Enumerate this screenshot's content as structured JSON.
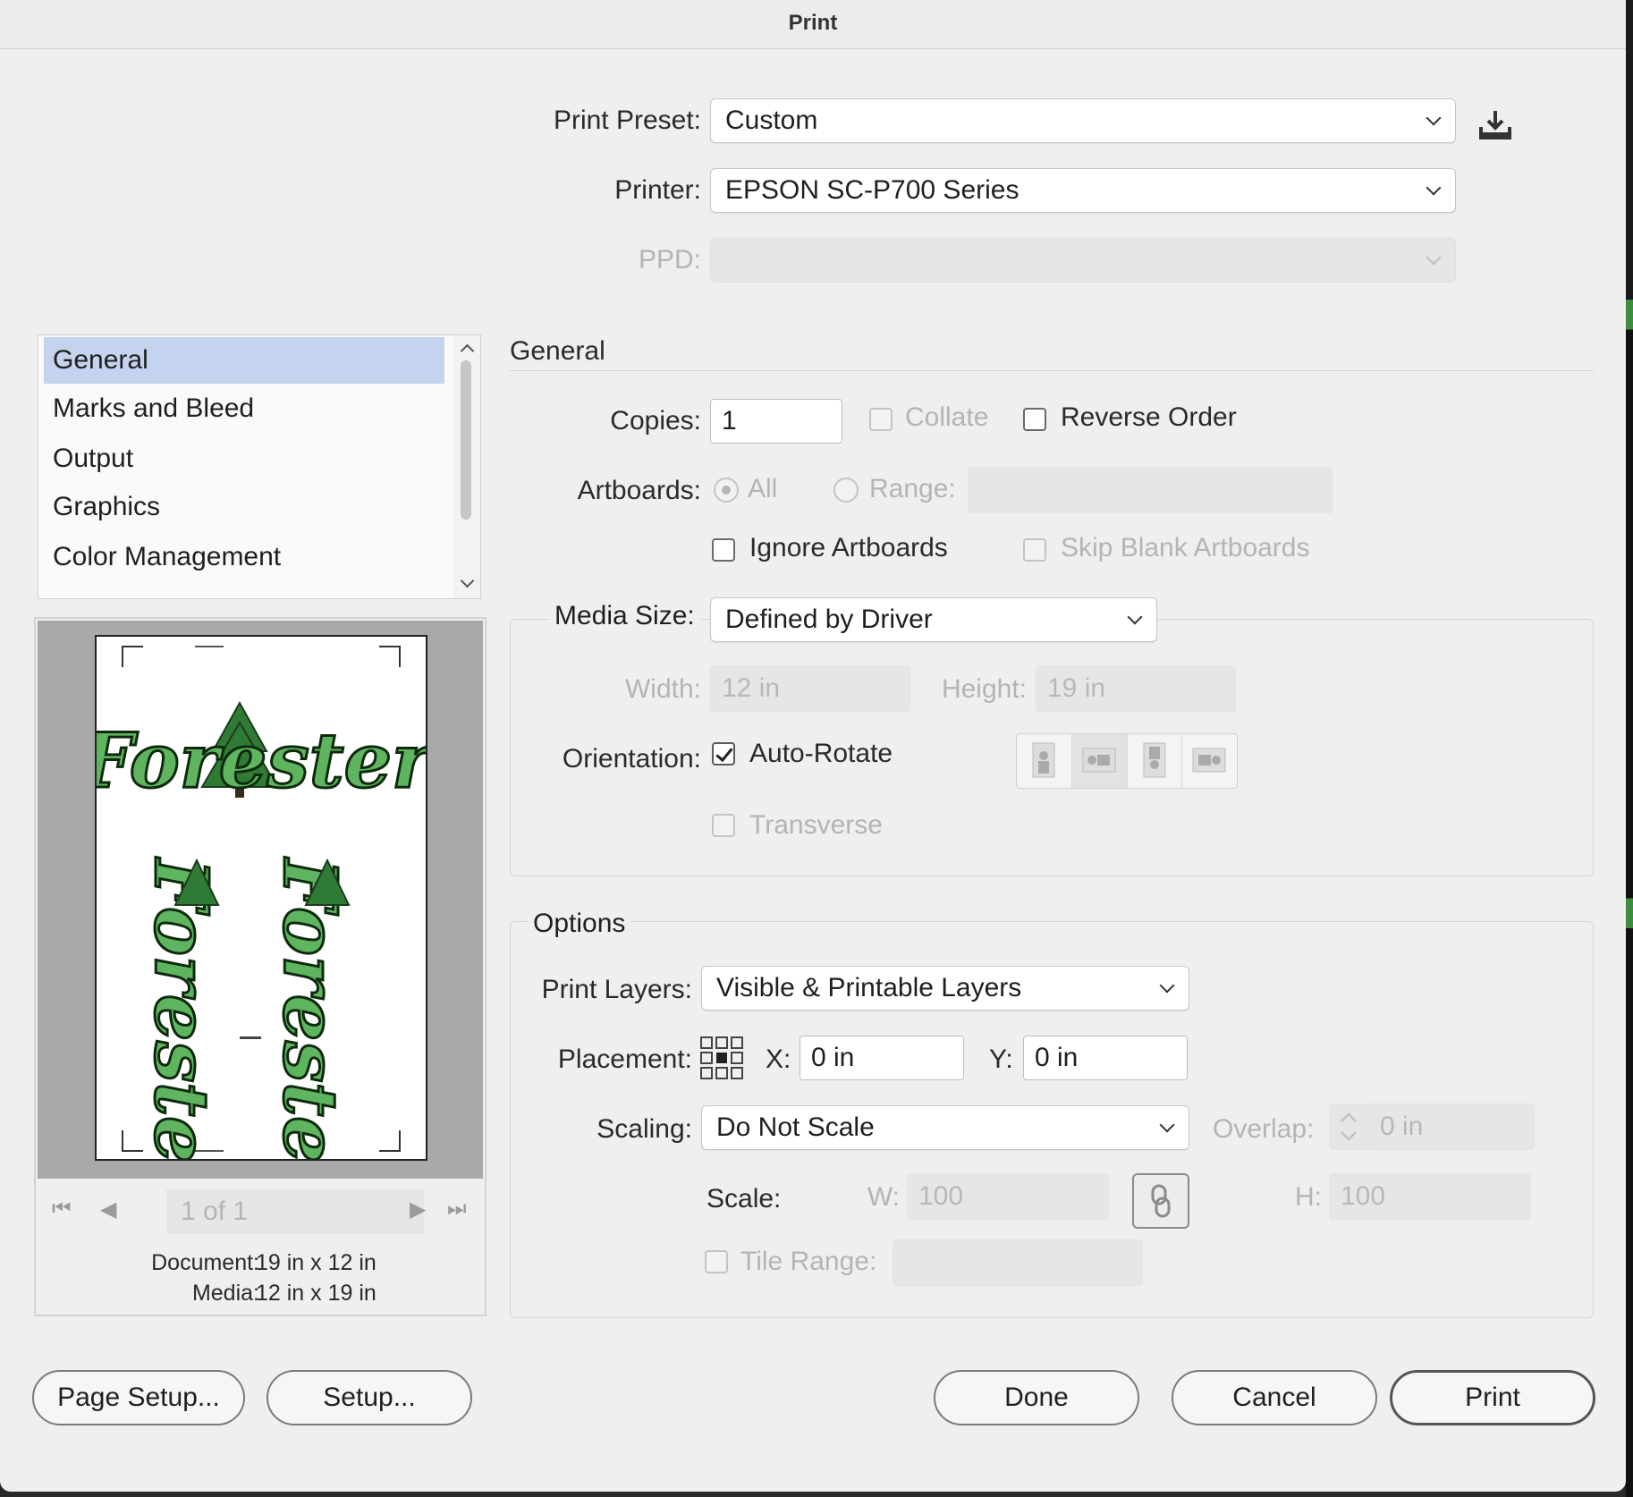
{
  "dialog": {
    "title": "Print"
  },
  "header": {
    "preset_label": "Print Preset:",
    "preset_value": "Custom",
    "printer_label": "Printer:",
    "printer_value": "EPSON SC-P700 Series",
    "ppd_label": "PPD:",
    "ppd_value": ""
  },
  "sidebar": {
    "items": [
      {
        "label": "General",
        "selected": true
      },
      {
        "label": "Marks and Bleed",
        "selected": false
      },
      {
        "label": "Output",
        "selected": false
      },
      {
        "label": "Graphics",
        "selected": false
      },
      {
        "label": "Color Management",
        "selected": false
      }
    ]
  },
  "preview": {
    "artwork_text": "Forester",
    "page_field": "1 of 1",
    "document_label": "Document:",
    "document_value": "19 in x 12 in",
    "media_label": "Media:",
    "media_value": "12 in x 19 in"
  },
  "general": {
    "heading": "General",
    "copies_label": "Copies:",
    "copies_value": "1",
    "collate_label": "Collate",
    "collate_checked": false,
    "reverse_label": "Reverse Order",
    "reverse_checked": false,
    "artboards_label": "Artboards:",
    "all_label": "All",
    "range_label": "Range:",
    "range_value": "",
    "ignore_label": "Ignore Artboards",
    "ignore_checked": false,
    "skip_label": "Skip Blank Artboards",
    "skip_checked": false
  },
  "media": {
    "size_label": "Media Size:",
    "size_value": "Defined by Driver",
    "width_label": "Width:",
    "width_value": "12 in",
    "height_label": "Height:",
    "height_value": "19 in",
    "orientation_label": "Orientation:",
    "autorotate_label": "Auto-Rotate",
    "autorotate_checked": true,
    "transverse_label": "Transverse",
    "transverse_checked": false,
    "orientation_icons": [
      "portrait-icon",
      "landscape-icon",
      "portrait-flipped-icon",
      "landscape-flipped-icon"
    ]
  },
  "options": {
    "heading": "Options",
    "layers_label": "Print Layers:",
    "layers_value": "Visible & Printable Layers",
    "placement_label": "Placement:",
    "x_label": "X:",
    "x_value": "0 in",
    "y_label": "Y:",
    "y_value": "0 in",
    "scaling_label": "Scaling:",
    "scaling_value": "Do Not Scale",
    "overlap_label": "Overlap:",
    "overlap_value": "0 in",
    "scale_label": "Scale:",
    "w_label": "W:",
    "w_value": "100",
    "h_label": "H:",
    "h_value": "100",
    "tile_label": "Tile Range:",
    "tile_value": ""
  },
  "buttons": {
    "page_setup": "Page Setup...",
    "setup": "Setup...",
    "done": "Done",
    "cancel": "Cancel",
    "print": "Print"
  }
}
